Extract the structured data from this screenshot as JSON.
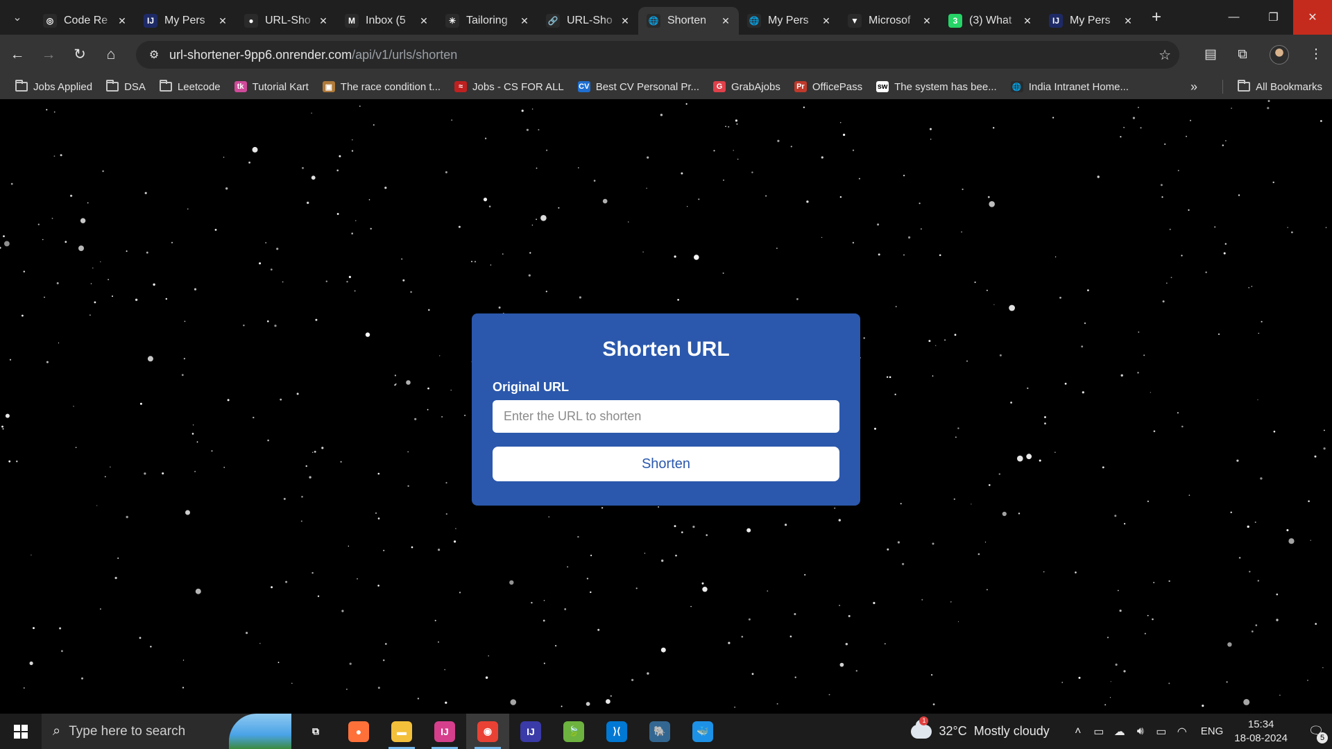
{
  "browser": {
    "tabs": [
      {
        "title": "Code Re",
        "icon": "openai-icon",
        "color": "#2a2a2a",
        "glyph": "◎"
      },
      {
        "title": "My Pers",
        "icon": "intellij-icon",
        "color": "#1e2a66",
        "glyph": "IJ"
      },
      {
        "title": "URL-Sho",
        "icon": "github-icon",
        "color": "#2a2a2a",
        "glyph": "●"
      },
      {
        "title": "Inbox (5",
        "icon": "gmail-icon",
        "color": "#2a2a2a",
        "glyph": "M"
      },
      {
        "title": "Tailoring",
        "icon": "claude-icon",
        "color": "#2a2a2a",
        "glyph": "✳"
      },
      {
        "title": "URL-Sho",
        "icon": "link-icon",
        "color": "#2a2a2a",
        "glyph": "🔗"
      },
      {
        "title": "Shorten",
        "icon": "globe-icon",
        "color": "#2a2a2a",
        "glyph": "🌐",
        "active": true
      },
      {
        "title": "My Pers",
        "icon": "globe-icon",
        "color": "#2a2a2a",
        "glyph": "🌐"
      },
      {
        "title": "Microsof",
        "icon": "vuetify-icon",
        "color": "#2a2a2a",
        "glyph": "▼"
      },
      {
        "title": "(3) What",
        "icon": "whatsapp-icon",
        "color": "#25d366",
        "glyph": "3"
      },
      {
        "title": "My Pers",
        "icon": "intellij-icon",
        "color": "#1e2a66",
        "glyph": "IJ"
      }
    ],
    "url_host": "url-shortener-9pp6.onrender.com",
    "url_path": "/api/v1/urls/shorten",
    "bookmarks": [
      {
        "label": "Jobs Applied",
        "type": "folder"
      },
      {
        "label": "DSA",
        "type": "folder"
      },
      {
        "label": "Leetcode",
        "type": "folder"
      },
      {
        "label": "Tutorial Kart",
        "type": "site",
        "color": "#d04a9a",
        "glyph": "tk"
      },
      {
        "label": "The race condition t...",
        "type": "site",
        "color": "#b07a3a",
        "glyph": "▣"
      },
      {
        "label": "Jobs - CS FOR ALL",
        "type": "site",
        "color": "#c02020",
        "glyph": "≈"
      },
      {
        "label": "Best CV Personal Pr...",
        "type": "site",
        "color": "#1f6fd1",
        "glyph": "CV"
      },
      {
        "label": "GrabAjobs",
        "type": "site",
        "color": "#e0404a",
        "glyph": "G"
      },
      {
        "label": "OfficePass",
        "type": "site",
        "color": "#c0392b",
        "glyph": "Pr"
      },
      {
        "label": "The system has bee...",
        "type": "site",
        "color": "#ffffff",
        "glyph": "sw"
      },
      {
        "label": "India Intranet Home...",
        "type": "site",
        "color": "#2a2a2a",
        "glyph": "🌐"
      }
    ],
    "all_bookmarks": "All Bookmarks"
  },
  "form": {
    "title": "Shorten URL",
    "field_label": "Original URL",
    "placeholder": "Enter the URL to shorten",
    "button": "Shorten"
  },
  "taskbar": {
    "search_placeholder": "Type here to search",
    "weather": "32°C  Mostly cloudy",
    "weather_badge": "1",
    "language": "ENG",
    "time": "15:34",
    "date": "18-08-2024",
    "notifications": "5",
    "apps": [
      {
        "name": "task-view",
        "color": "transparent",
        "glyph": "⧉"
      },
      {
        "name": "firefox",
        "color": "#ff7139",
        "glyph": "●"
      },
      {
        "name": "file-explorer",
        "color": "#f3c03b",
        "glyph": "▬"
      },
      {
        "name": "intellij",
        "color": "#d63f8c",
        "glyph": "IJ"
      },
      {
        "name": "chrome",
        "color": "#e94235",
        "glyph": "◉",
        "active": true
      },
      {
        "name": "intellij-2",
        "color": "#3a3aa8",
        "glyph": "IJ"
      },
      {
        "name": "spring-tool-suite",
        "color": "#6db33f",
        "glyph": "🍃"
      },
      {
        "name": "vscode",
        "color": "#0078d4",
        "glyph": "⟩⟨"
      },
      {
        "name": "pgadmin",
        "color": "#336791",
        "glyph": "🐘"
      },
      {
        "name": "docker",
        "color": "#1d91e6",
        "glyph": "🐳"
      }
    ]
  }
}
